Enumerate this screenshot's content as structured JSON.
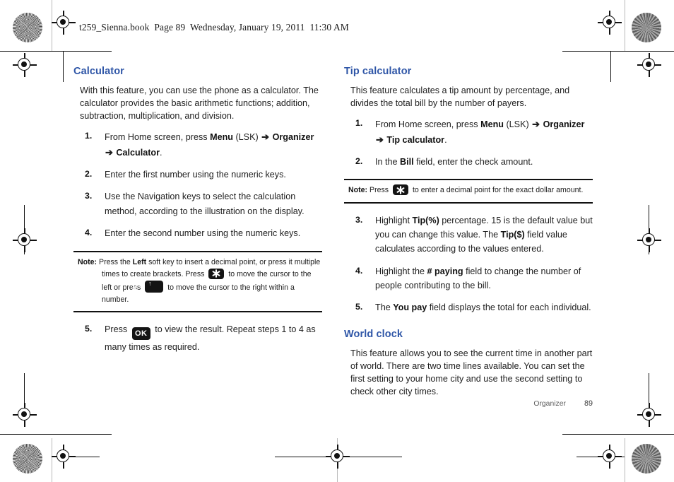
{
  "header": {
    "running_head": "t259_Sienna.book  Page 89  Wednesday, January 19, 2011  11:30 AM"
  },
  "left_column": {
    "heading": "Calculator",
    "intro": "With this feature, you can use the phone as a calculator. The calculator provides the basic arithmetic functions; addition, subtraction, multiplication, and division.",
    "steps": [
      {
        "num": "1.",
        "text_before": "From Home screen, press ",
        "bold1": "Menu",
        "mid1": " (LSK) ",
        "arrow1": "➔",
        "bold2": " Organizer ",
        "arrow2": "➔",
        "bold3": " Calculator",
        "tail": "."
      },
      {
        "num": "2.",
        "text": "Enter the first number using the numeric keys."
      },
      {
        "num": "3.",
        "text": "Use the Navigation keys to select the calculation method, according to the illustration on the display."
      },
      {
        "num": "4.",
        "text": "Enter the second number using the numeric keys."
      }
    ],
    "note": {
      "label": "Note:",
      "part1": " Press the ",
      "bold1": "Left",
      "part2": " soft key to insert a decimal point, or press it multiple times to create brackets. Press ",
      "key1": "star-key",
      "part3": " to move the cursor to the left or press ",
      "key2": "hash-key",
      "part4": " to move the cursor to the right within a number."
    },
    "step5": {
      "num": "5.",
      "part1": "Press ",
      "key": "ok-key",
      "part2": " to view the result. Repeat steps 1 to 4 as many times as required."
    }
  },
  "right_column": {
    "heading": "Tip calculator",
    "intro": "This feature calculates a tip amount by percentage, and divides the total bill by the number of payers.",
    "step1": {
      "num": "1.",
      "text_before": "From Home screen, press ",
      "bold1": "Menu",
      "mid1": " (LSK) ",
      "arrow1": "➔",
      "bold2": " Organizer ",
      "arrow2": "➔",
      "bold3": " Tip calculator",
      "tail": "."
    },
    "step2": {
      "num": "2.",
      "part1": "In the ",
      "bold1": "Bill",
      "part2": " field, enter the check amount."
    },
    "note": {
      "label": "Note:",
      "part1": " Press ",
      "key1": "star-key",
      "part2": " to enter a decimal point for the exact dollar amount."
    },
    "step3": {
      "num": "3.",
      "part1": "Highlight ",
      "bold1": "Tip(%)",
      "part2": " percentage. 15 is the default value but you can change this value. The ",
      "bold2": "Tip($)",
      "part3": " field value calculates according to the values entered."
    },
    "step4": {
      "num": "4.",
      "part1": "Highlight the ",
      "bold1": "# paying",
      "part2": " field to change the number of people contributing to the bill."
    },
    "step5": {
      "num": "5.",
      "part1": "The ",
      "bold1": "You pay",
      "part2": " field displays the total for each individual."
    },
    "heading2": "World clock",
    "intro2": "This feature allows you to see the current time in another part of world. There are two time lines available. You can set the first setting to your home city and use the second setting to check other city times."
  },
  "footer": {
    "section": "Organizer",
    "page": "89"
  },
  "icons": {
    "star_key": "star-key-icon",
    "hash_key": "hash-key-icon",
    "ok_key": "ok-key-icon",
    "registration_mark": "registration-target-icon",
    "density_patch": "print-density-patch-icon"
  },
  "colors": {
    "heading_blue": "#2f56a7",
    "body_text": "#1d1d1d",
    "key_chip": "#141414",
    "rule": "#111111",
    "footer_text": "#5c5c5c"
  }
}
